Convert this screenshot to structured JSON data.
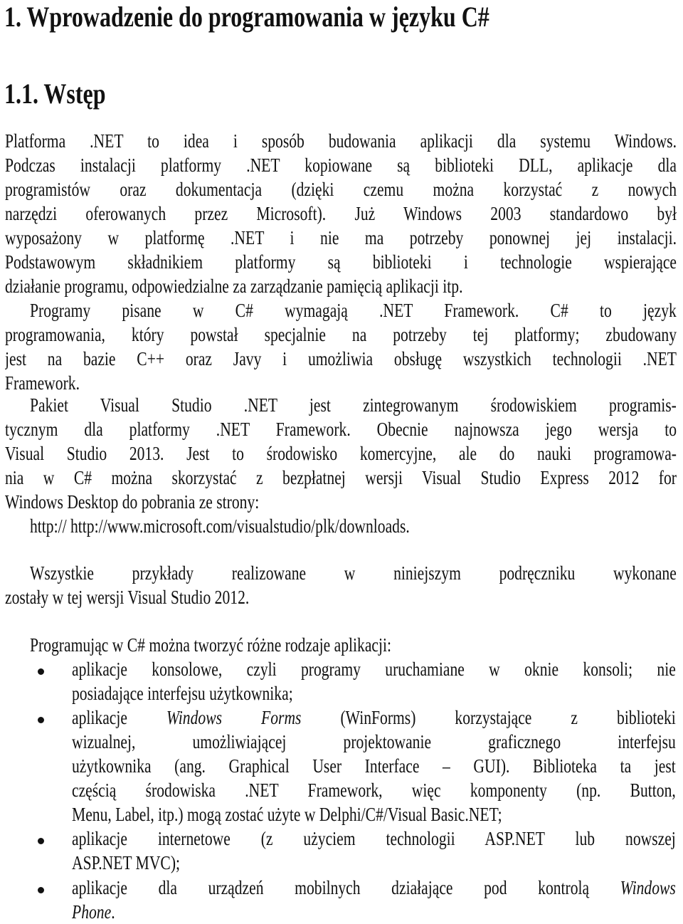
{
  "document": {
    "chapter_title": "1. Wprowadzenie do programowania w języku C#",
    "section_title": "1.1. Wstęp",
    "paragraph1_lines": [
      "Platforma .NET to idea i sposób budowania aplikacji dla systemu Windows.",
      "Podczas instalacji platformy .NET kopiowane są biblioteki DLL, aplikacje dla",
      "programistów oraz dokumentacja (dzięki czemu można korzystać z nowych",
      "narzędzi oferowanych przez Microsoft). Już Windows 2003 standardowo był",
      "wyposażony w platformę .NET i nie ma potrzeby ponownej jej instalacji.",
      "Podstawowym składnikiem platformy są biblioteki i technologie wspierające",
      "działanie programu, odpowiedzialne za zarządzanie pamięcią aplikacji itp."
    ],
    "paragraph2_lines": [
      "Programy pisane w C# wymagają .NET Framework. C# to język",
      "programowania, który powstał specjalnie na potrzeby tej platformy; zbudowany",
      "jest na bazie C++ oraz Javy i umożliwia obsługę wszystkich technologii .NET",
      "Framework."
    ],
    "paragraph3_lines": [
      "Pakiet Visual Studio .NET jest zintegrowanym środowiskiem programis-",
      "tycznym dla platformy .NET Framework. Obecnie najnowsza jego wersja to",
      "Visual Studio 2013. Jest to środowisko komercyjne, ale do nauki programowa-",
      "nia w C# można skorzystać z bezpłatnej wersji Visual Studio Express 2012 for",
      "Windows Desktop do pobrania ze strony:"
    ],
    "download_link": "http:// http://www.microsoft.com/visualstudio/plk/downloads.",
    "paragraph4_lines": [
      "Wszystkie przykłady realizowane w niniejszym podręczniku wykonane",
      "zostały w tej wersji Visual Studio 2012."
    ],
    "list_intro": "Programując w C# można tworzyć różne rodzaje aplikacji:",
    "list_items": [
      {
        "lines": [
          "aplikacje konsolowe, czyli programy uruchamiane w oknie konsoli; nie",
          "posiadające interfejsu użytkownika;"
        ]
      },
      {
        "line1_before": "aplikacje",
        "line1_italic": "Windows Forms",
        "line1_after": "(WinForms) korzystające z biblioteki",
        "lines": [
          "wizualnej, umożliwiającej projektowanie graficznego interfejsu",
          "użytkownika (ang. Graphical User Interface – GUI). Biblioteka ta jest",
          "częścią środowiska .NET Framework, więc komponenty (np. Button,",
          "Menu, Label, itp.) mogą zostać użyte w Delphi/C#/Visual Basic.NET;"
        ]
      },
      {
        "lines": [
          "aplikacje internetowe (z użyciem technologii ASP.NET lub nowszej",
          "ASP.NET MVC);"
        ]
      },
      {
        "line1_before": "aplikacje dla urządzeń mobilnych działające pod kontrolą",
        "line1_italic": "Windows",
        "line2_italic": "Phone",
        "line2_after": "."
      }
    ]
  }
}
